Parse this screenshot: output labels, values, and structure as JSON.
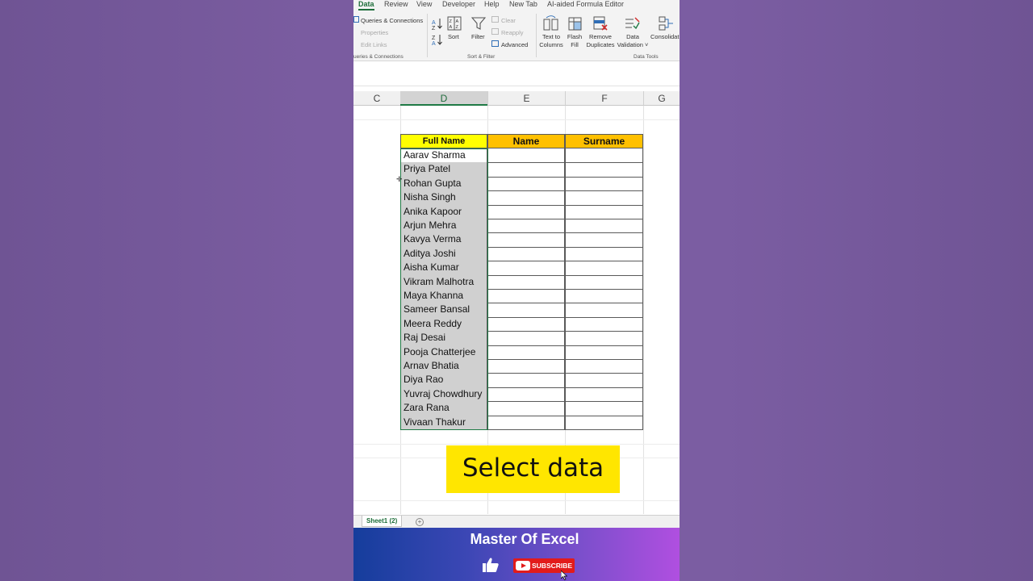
{
  "ribbon": {
    "tabs": [
      "Data",
      "Review",
      "View",
      "Developer",
      "Help",
      "New Tab",
      "AI-aided Formula Editor"
    ],
    "active_tab": "Data",
    "queries": {
      "connections": "Queries & Connections",
      "properties": "Properties",
      "edit_links": "Edit Links",
      "group_label": "ueries & Connections"
    },
    "sort_filter": {
      "sort": "Sort",
      "filter": "Filter",
      "clear": "Clear",
      "reapply": "Reapply",
      "advanced": "Advanced",
      "group_label": "Sort & Filter"
    },
    "data_tools": {
      "text_to_columns_1": "Text to",
      "text_to_columns_2": "Columns",
      "flash_fill_1": "Flash",
      "flash_fill_2": "Fill",
      "remove_dup_1": "Remove",
      "remove_dup_2": "Duplicates",
      "data_validation_1": "Data",
      "data_validation_2": "Validation ˅",
      "consolidate": "Consolidat",
      "group_label": "Data Tools"
    }
  },
  "sheet": {
    "columns": [
      "C",
      "D",
      "E",
      "F",
      "G"
    ],
    "selected_column": "D",
    "headers": [
      "Full Name",
      "Name",
      "Surname"
    ],
    "full_names": [
      "Aarav Sharma",
      "Priya Patel",
      "Rohan Gupta",
      "Nisha Singh",
      "Anika Kapoor",
      "Arjun Mehra",
      "Kavya Verma",
      "Aditya Joshi",
      "Aisha Kumar",
      "Vikram Malhotra",
      "Maya Khanna",
      "Sameer Bansal",
      "Meera Reddy",
      "Raj Desai",
      "Pooja Chatterjee",
      "Arnav Bhatia",
      "Diya Rao",
      "Yuvraj Chowdhury",
      "Zara Rana",
      "Vivaan Thakur"
    ],
    "colors": {
      "header_yellow": "#ffff00",
      "header_orange": "#ffc000",
      "selection_gray": "#d0d0d0",
      "excel_green": "#1e6e3a"
    }
  },
  "caption": "Select data",
  "sheet_tab": "Sheet1 (2)",
  "add_sheet_icon": "plus-circle-icon",
  "banner": {
    "brand": "Master Of Excel",
    "subscribe": "SUBSCRIBE",
    "like_icon": "thumbs-up-icon"
  }
}
